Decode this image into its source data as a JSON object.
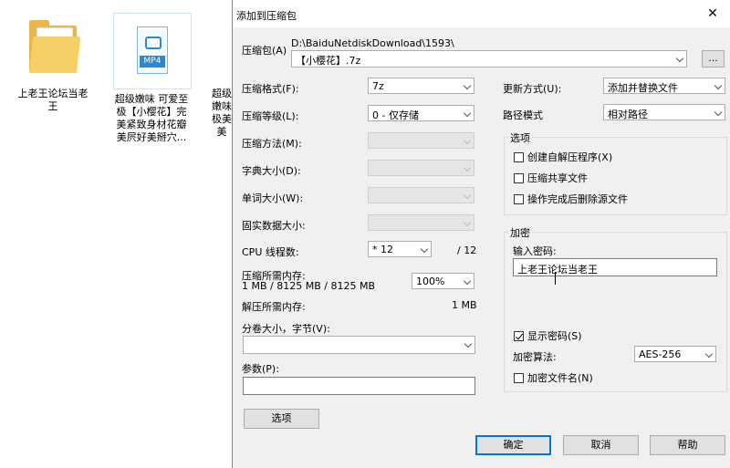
{
  "desktop": {
    "files": [
      {
        "label": "上老王论坛当老王"
      },
      {
        "label": "超级嫩味 可爱至极【小樱花】完美紧致身材花瓣美屄好美掰穴...",
        "badge": "MP4"
      },
      {
        "label": "超级嫩味极美美"
      }
    ]
  },
  "dialog": {
    "title": "添加到压缩包",
    "close": "✕",
    "archive": {
      "label": "压缩包(A)",
      "path": "D:\\BaiduNetdiskDownload\\1593\\",
      "name": "【小樱花】.7z",
      "browse": "..."
    },
    "left": {
      "format_label": "压缩格式(F):",
      "format_value": "7z",
      "level_label": "压缩等级(L):",
      "level_value": "0 - 仅存储",
      "method_label": "压缩方法(M):",
      "dict_label": "字典大小(D):",
      "word_label": "单词大小(W):",
      "solid_label": "固实数据大小:",
      "cpu_label": "CPU 线程数:",
      "cpu_value": "* 12",
      "cpu_max": "/ 12",
      "mem_label": "压缩所需内存:",
      "mem_value": "1 MB / 8125 MB / 8125 MB",
      "mem_percent": "100%",
      "decomp_label": "解压所需内存:",
      "decomp_value": "1 MB",
      "split_label": "分卷大小，字节(V):",
      "split_value": "",
      "params_label": "参数(P):",
      "params_value": "",
      "options_button": "选项"
    },
    "right": {
      "update_label": "更新方式(U):",
      "update_value": "添加并替换文件",
      "path_label": "路径模式",
      "path_value": "相对路径",
      "options_group": "选项",
      "sfx": "创建自解压程序(X)",
      "sfx_checked": false,
      "shared": "压缩共享文件",
      "shared_checked": false,
      "delete": "操作完成后删除源文件",
      "delete_checked": false,
      "encrypt_group": "加密",
      "password_label": "输入密码:",
      "password_value": "上老王论坛当老王",
      "show_password": "显示密码(S)",
      "show_password_checked": true,
      "method_label": "加密算法:",
      "method_value": "AES-256",
      "encrypt_names": "加密文件名(N)",
      "encrypt_names_checked": false
    },
    "buttons": {
      "ok": "确定",
      "cancel": "取消",
      "help": "帮助"
    }
  }
}
